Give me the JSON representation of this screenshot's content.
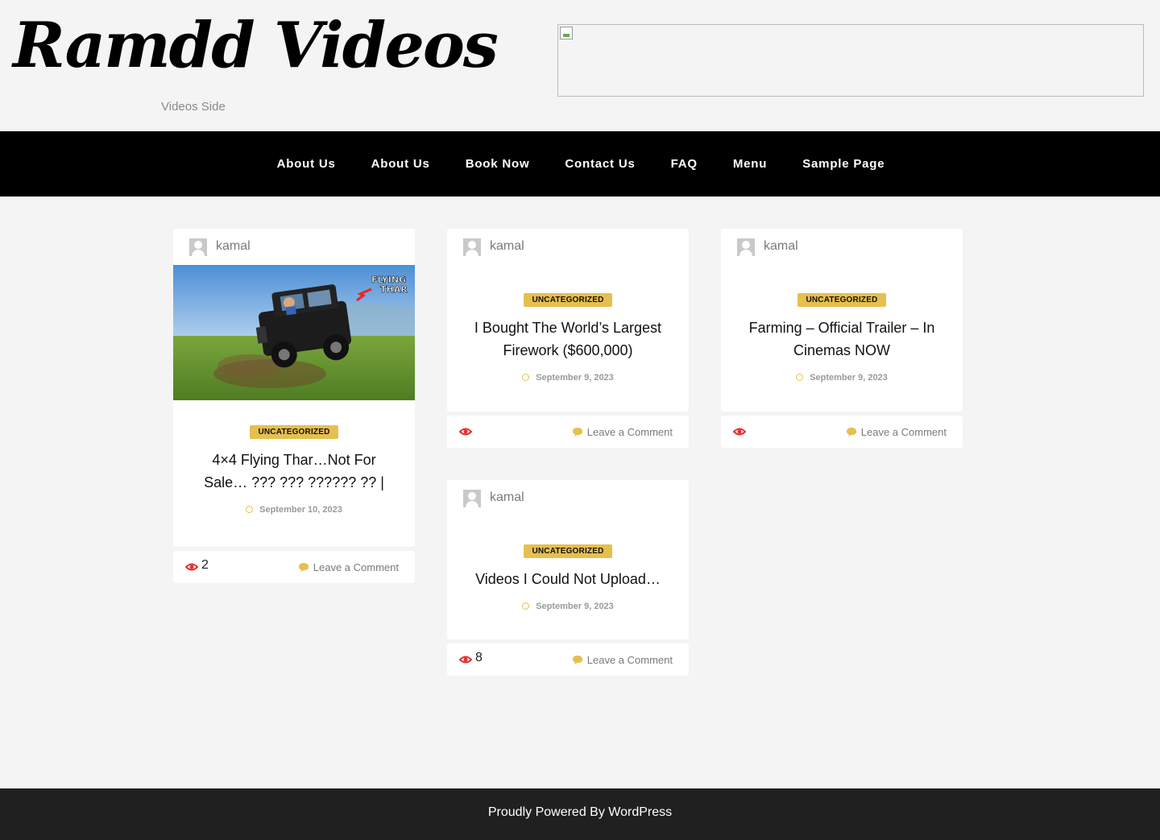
{
  "header": {
    "site_title": "Ramdd Videos",
    "tagline": "Videos Side"
  },
  "nav": {
    "items": [
      {
        "label": "About Us"
      },
      {
        "label": "About Us"
      },
      {
        "label": "Book Now"
      },
      {
        "label": "Contact Us"
      },
      {
        "label": "FAQ"
      },
      {
        "label": "Menu"
      },
      {
        "label": "Sample Page"
      }
    ]
  },
  "posts": [
    {
      "author": "kamal",
      "category": "UNCATEGORIZED",
      "title": "4×4 Flying Thar…Not For Sale… ??? ??? ?????? ?? |",
      "date": "September 10, 2023",
      "views": "2",
      "comment_label": "Leave a Comment",
      "thumbnail_text": "FLYING THAR"
    },
    {
      "author": "kamal",
      "category": "UNCATEGORIZED",
      "title": "I Bought The World’s Largest Firework ($600,000)",
      "date": "September 9, 2023",
      "views": "",
      "comment_label": "Leave a Comment"
    },
    {
      "author": "kamal",
      "category": "UNCATEGORIZED",
      "title": "Farming – Official Trailer – In Cinemas NOW",
      "date": "September 9, 2023",
      "views": "",
      "comment_label": "Leave a Comment"
    },
    {
      "author": "kamal",
      "category": "UNCATEGORIZED",
      "title": "Videos I Could Not Upload…",
      "date": "September 9, 2023",
      "views": "8",
      "comment_label": "Leave a Comment"
    }
  ],
  "footer": {
    "text": "Proudly Powered By WordPress"
  },
  "colors": {
    "accent": "#e6bf4f",
    "nav_background": "#000000",
    "footer_background": "#202020",
    "views_icon": "#e03030",
    "page_background": "#f4f4f4"
  },
  "icons": [
    "broken-image-icon",
    "avatar-icon",
    "clock-icon",
    "eye-icon",
    "comment-icon"
  ]
}
